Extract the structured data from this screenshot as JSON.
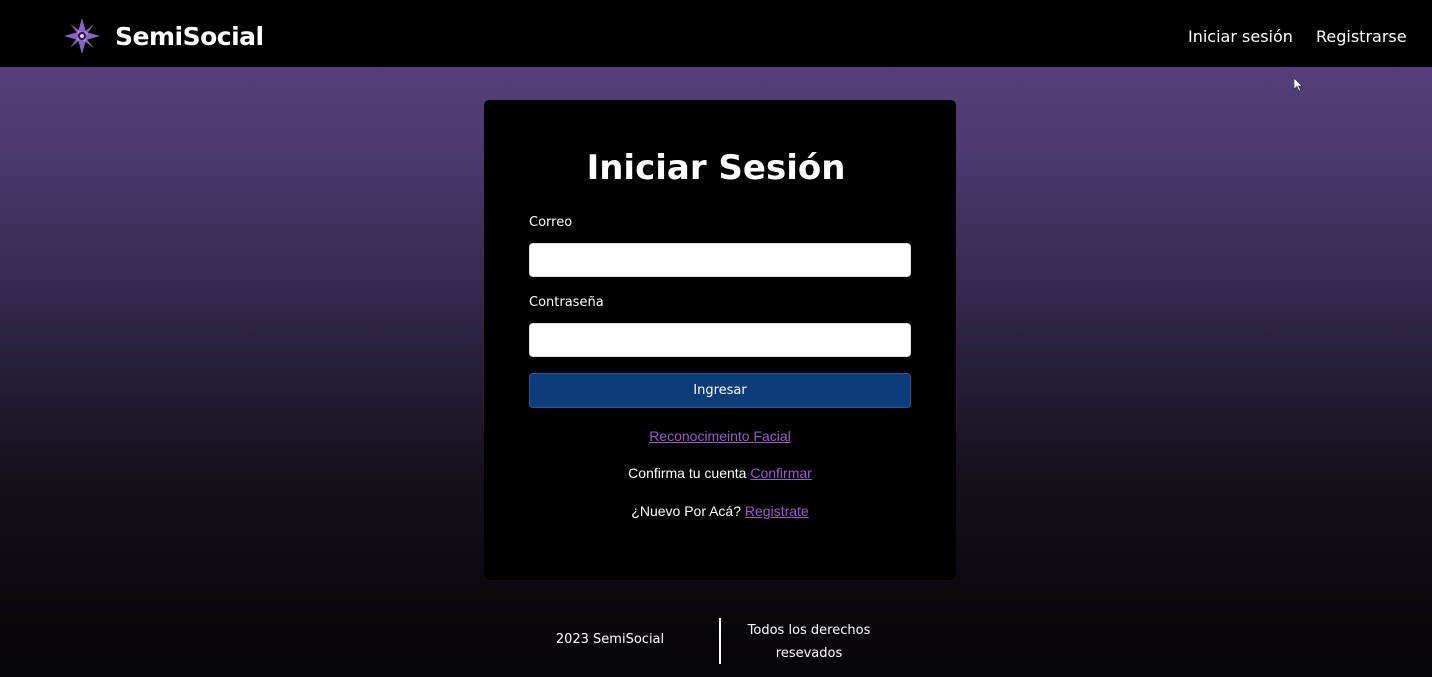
{
  "navbar": {
    "brand": "SemiSocial",
    "logo_icon": "compass-star-icon",
    "links": [
      {
        "label": "Iniciar sesión"
      },
      {
        "label": "Registrarse"
      }
    ]
  },
  "login_card": {
    "title": "Iniciar Sesión",
    "email_label": "Correo",
    "email_value": "",
    "password_label": "Contraseña",
    "password_value": "",
    "submit_label": "Ingresar",
    "facial_link": "Reconocimeinto Facial",
    "confirm_text": "Confirma tu cuenta",
    "confirm_link": "Confirmar",
    "register_text": "¿Nuevo Por Acá?",
    "register_link": "Registrate"
  },
  "footer": {
    "copyright": "2023 SemiSocial",
    "rights": "Todos los derechos resevados"
  },
  "colors": {
    "accent_link": "#9b59c9",
    "button": "#0d3c7b",
    "gradient_top": "#5a4382",
    "gradient_bottom": "#050407"
  }
}
